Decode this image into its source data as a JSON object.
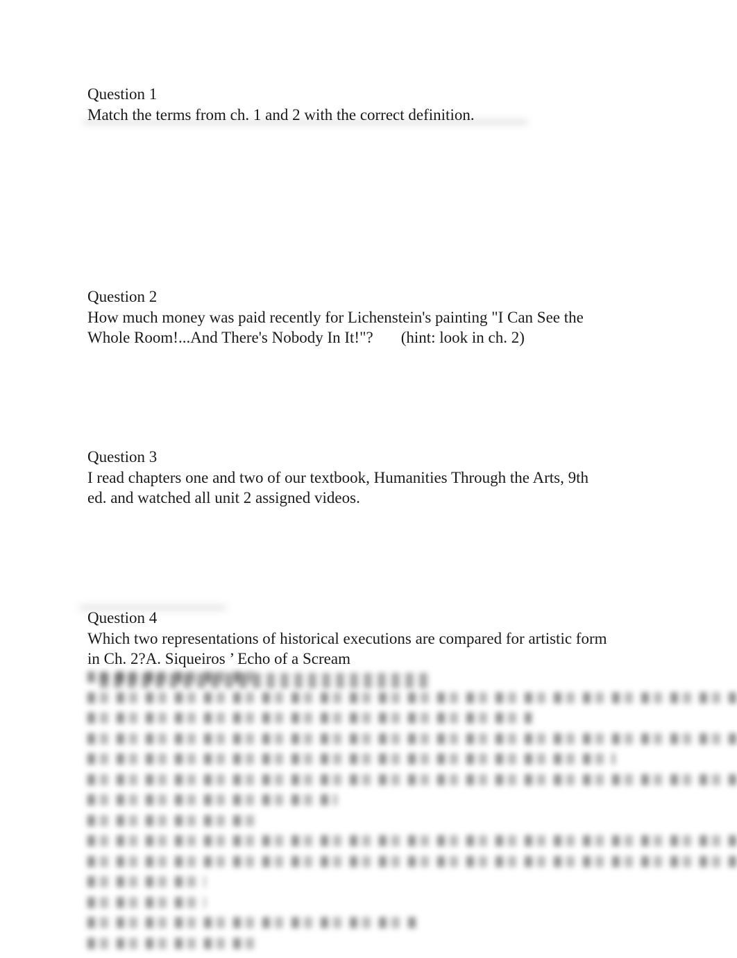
{
  "questions": [
    {
      "title": "Question 1",
      "text": "Match the terms from ch. 1 and 2 with the correct definition."
    },
    {
      "title": "Question 2",
      "text": "How much money was paid recently for Lichenstein's painting \"I Can See the Whole Room!...And There's Nobody In It!\"?",
      "hint": "(hint:  look in ch. 2)"
    },
    {
      "title": "Question 3",
      "text": "I read chapters one and two of our textbook, Humanities Through the Arts, 9th ed. and watched all unit 2 assigned videos."
    },
    {
      "title": "Question 4",
      "text": "Which two representations of historical executions are compared for artistic form in Ch. 2?A.  Siqueiros  ’ Echo of a Scream"
    }
  ],
  "blurred_content": {
    "note": "remaining content obscured (blurred preview)",
    "line_count": 14
  }
}
